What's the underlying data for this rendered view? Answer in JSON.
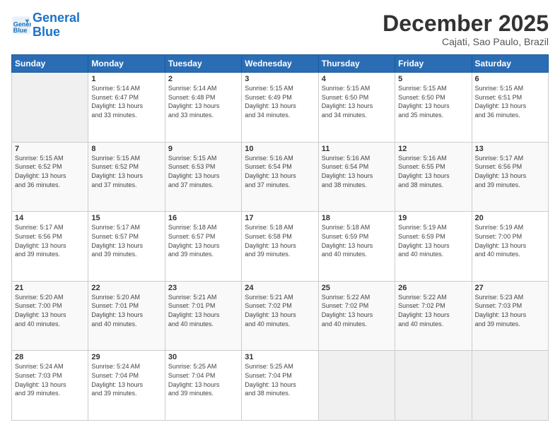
{
  "logo": {
    "line1": "General",
    "line2": "Blue"
  },
  "header": {
    "month": "December 2025",
    "location": "Cajati, Sao Paulo, Brazil"
  },
  "weekdays": [
    "Sunday",
    "Monday",
    "Tuesday",
    "Wednesday",
    "Thursday",
    "Friday",
    "Saturday"
  ],
  "weeks": [
    [
      {
        "day": "",
        "info": ""
      },
      {
        "day": "1",
        "info": "Sunrise: 5:14 AM\nSunset: 6:47 PM\nDaylight: 13 hours\nand 33 minutes."
      },
      {
        "day": "2",
        "info": "Sunrise: 5:14 AM\nSunset: 6:48 PM\nDaylight: 13 hours\nand 33 minutes."
      },
      {
        "day": "3",
        "info": "Sunrise: 5:15 AM\nSunset: 6:49 PM\nDaylight: 13 hours\nand 34 minutes."
      },
      {
        "day": "4",
        "info": "Sunrise: 5:15 AM\nSunset: 6:50 PM\nDaylight: 13 hours\nand 34 minutes."
      },
      {
        "day": "5",
        "info": "Sunrise: 5:15 AM\nSunset: 6:50 PM\nDaylight: 13 hours\nand 35 minutes."
      },
      {
        "day": "6",
        "info": "Sunrise: 5:15 AM\nSunset: 6:51 PM\nDaylight: 13 hours\nand 36 minutes."
      }
    ],
    [
      {
        "day": "7",
        "info": "Sunrise: 5:15 AM\nSunset: 6:52 PM\nDaylight: 13 hours\nand 36 minutes."
      },
      {
        "day": "8",
        "info": "Sunrise: 5:15 AM\nSunset: 6:52 PM\nDaylight: 13 hours\nand 37 minutes."
      },
      {
        "day": "9",
        "info": "Sunrise: 5:15 AM\nSunset: 6:53 PM\nDaylight: 13 hours\nand 37 minutes."
      },
      {
        "day": "10",
        "info": "Sunrise: 5:16 AM\nSunset: 6:54 PM\nDaylight: 13 hours\nand 37 minutes."
      },
      {
        "day": "11",
        "info": "Sunrise: 5:16 AM\nSunset: 6:54 PM\nDaylight: 13 hours\nand 38 minutes."
      },
      {
        "day": "12",
        "info": "Sunrise: 5:16 AM\nSunset: 6:55 PM\nDaylight: 13 hours\nand 38 minutes."
      },
      {
        "day": "13",
        "info": "Sunrise: 5:17 AM\nSunset: 6:56 PM\nDaylight: 13 hours\nand 39 minutes."
      }
    ],
    [
      {
        "day": "14",
        "info": "Sunrise: 5:17 AM\nSunset: 6:56 PM\nDaylight: 13 hours\nand 39 minutes."
      },
      {
        "day": "15",
        "info": "Sunrise: 5:17 AM\nSunset: 6:57 PM\nDaylight: 13 hours\nand 39 minutes."
      },
      {
        "day": "16",
        "info": "Sunrise: 5:18 AM\nSunset: 6:57 PM\nDaylight: 13 hours\nand 39 minutes."
      },
      {
        "day": "17",
        "info": "Sunrise: 5:18 AM\nSunset: 6:58 PM\nDaylight: 13 hours\nand 39 minutes."
      },
      {
        "day": "18",
        "info": "Sunrise: 5:18 AM\nSunset: 6:59 PM\nDaylight: 13 hours\nand 40 minutes."
      },
      {
        "day": "19",
        "info": "Sunrise: 5:19 AM\nSunset: 6:59 PM\nDaylight: 13 hours\nand 40 minutes."
      },
      {
        "day": "20",
        "info": "Sunrise: 5:19 AM\nSunset: 7:00 PM\nDaylight: 13 hours\nand 40 minutes."
      }
    ],
    [
      {
        "day": "21",
        "info": "Sunrise: 5:20 AM\nSunset: 7:00 PM\nDaylight: 13 hours\nand 40 minutes."
      },
      {
        "day": "22",
        "info": "Sunrise: 5:20 AM\nSunset: 7:01 PM\nDaylight: 13 hours\nand 40 minutes."
      },
      {
        "day": "23",
        "info": "Sunrise: 5:21 AM\nSunset: 7:01 PM\nDaylight: 13 hours\nand 40 minutes."
      },
      {
        "day": "24",
        "info": "Sunrise: 5:21 AM\nSunset: 7:02 PM\nDaylight: 13 hours\nand 40 minutes."
      },
      {
        "day": "25",
        "info": "Sunrise: 5:22 AM\nSunset: 7:02 PM\nDaylight: 13 hours\nand 40 minutes."
      },
      {
        "day": "26",
        "info": "Sunrise: 5:22 AM\nSunset: 7:02 PM\nDaylight: 13 hours\nand 40 minutes."
      },
      {
        "day": "27",
        "info": "Sunrise: 5:23 AM\nSunset: 7:03 PM\nDaylight: 13 hours\nand 39 minutes."
      }
    ],
    [
      {
        "day": "28",
        "info": "Sunrise: 5:24 AM\nSunset: 7:03 PM\nDaylight: 13 hours\nand 39 minutes."
      },
      {
        "day": "29",
        "info": "Sunrise: 5:24 AM\nSunset: 7:04 PM\nDaylight: 13 hours\nand 39 minutes."
      },
      {
        "day": "30",
        "info": "Sunrise: 5:25 AM\nSunset: 7:04 PM\nDaylight: 13 hours\nand 39 minutes."
      },
      {
        "day": "31",
        "info": "Sunrise: 5:25 AM\nSunset: 7:04 PM\nDaylight: 13 hours\nand 38 minutes."
      },
      {
        "day": "",
        "info": ""
      },
      {
        "day": "",
        "info": ""
      },
      {
        "day": "",
        "info": ""
      }
    ]
  ]
}
